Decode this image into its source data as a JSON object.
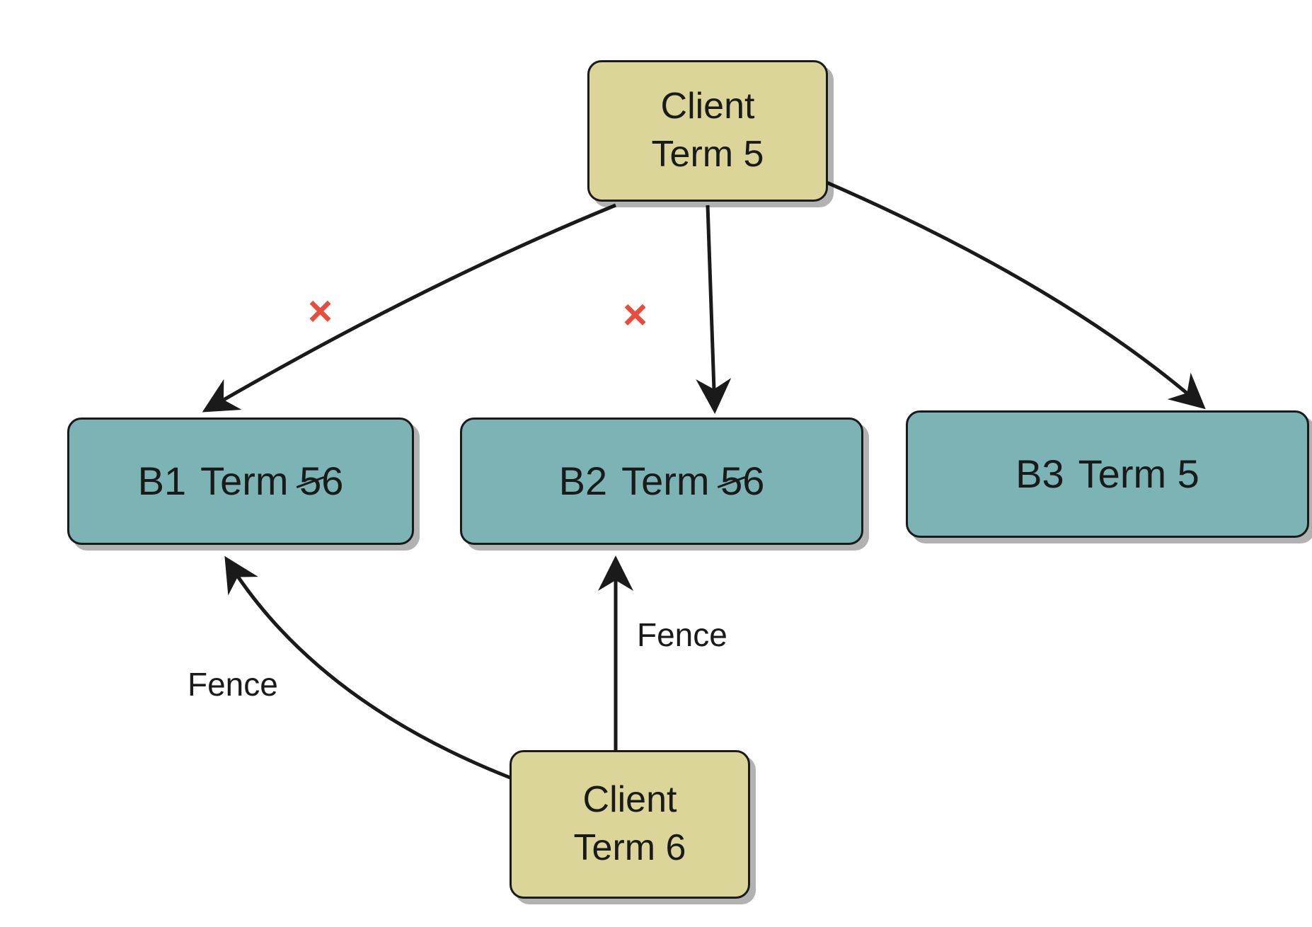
{
  "nodes": {
    "clientTop": {
      "line1": "Client",
      "line2": "Term 5"
    },
    "clientBottom": {
      "line1": "Client",
      "line2": "Term 6"
    },
    "b1": {
      "id": "B1",
      "prefix": "Term ",
      "struck": "5",
      "suffix": "6"
    },
    "b2": {
      "id": "B2",
      "prefix": "Term ",
      "struck": "5",
      "suffix": "6"
    },
    "b3": {
      "id": "B3",
      "label": "Term 5"
    }
  },
  "labels": {
    "fence1": "Fence",
    "fence2": "Fence"
  },
  "marks": {
    "cross1": "×",
    "cross2": "×"
  }
}
